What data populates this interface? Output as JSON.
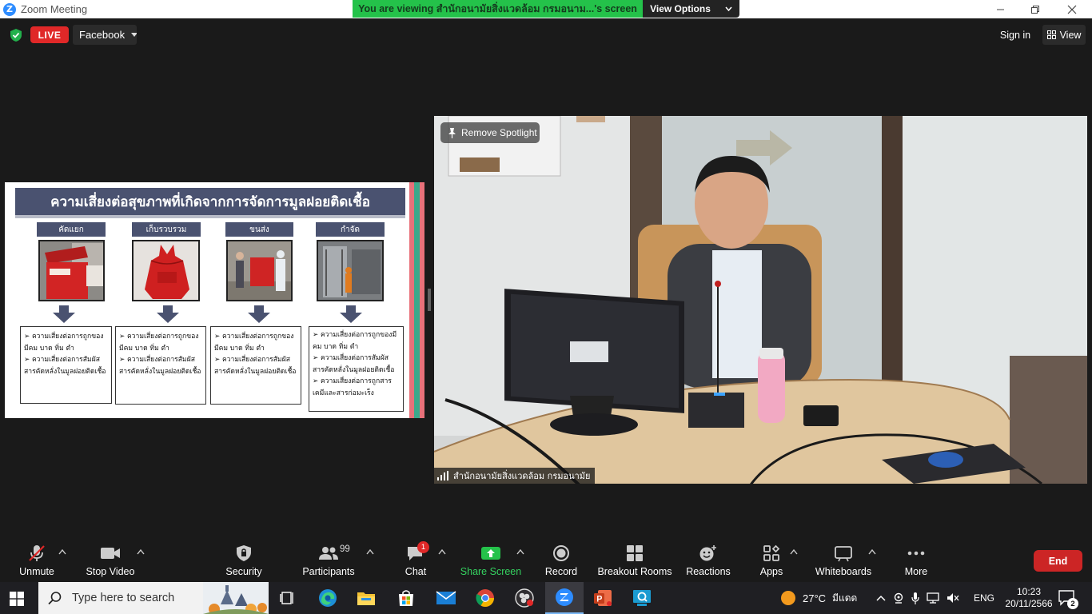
{
  "window": {
    "title": "Zoom Meeting",
    "logo_letter": "Z"
  },
  "banner": {
    "message": "You are viewing สำนักอนามัยสิ่งแวดล้อม กรมอนาม...'s screen",
    "view_options": "View Options"
  },
  "topbar": {
    "live_label": "LIVE",
    "stream_target": "Facebook",
    "sign_in": "Sign in",
    "view": "View"
  },
  "slide": {
    "title": "ความเสี่ยงต่อสุขภาพที่เกิดจากการจัดการมูลฝอยติดเชื้อ",
    "columns": [
      {
        "header": "คัดแยก",
        "bullets": [
          "ความเสี่ยงต่อการถูกของมีคม บาด ทิ่ม ตำ",
          "ความเสี่ยงต่อการสัมผัสสารคัดหลั่งในมูลฝอยติดเชื้อ"
        ]
      },
      {
        "header": "เก็บรวบรวม",
        "bullets": [
          "ความเสี่ยงต่อการถูกของมีคม บาด ทิ่ม ตำ",
          "ความเสี่ยงต่อการสัมผัสสารคัดหลั่งในมูลฝอยติดเชื้อ"
        ]
      },
      {
        "header": "ขนส่ง",
        "bullets": [
          "ความเสี่ยงต่อการถูกของมีคม บาด ทิ่ม ตำ",
          "ความเสี่ยงต่อการสัมผัสสารคัดหลั่งในมูลฝอยติดเชื้อ"
        ]
      },
      {
        "header": "กำจัด",
        "bullets": [
          "ความเสี่ยงต่อการถูกของมีคม บาด ทิ่ม ตำ",
          "ความเสี่ยงต่อการสัมผัสสารคัดหลั่งในมูลฝอยติดเชื้อ",
          "ความเสี่ยงต่อการถูกสารเคมีและสารก่อมะเร็ง"
        ]
      }
    ]
  },
  "video": {
    "remove_spotlight": "Remove Spotlight",
    "participant_name": "สำนักอนามัยสิ่งแวดล้อม กรมอนามัย"
  },
  "toolbar": {
    "unmute": "Unmute",
    "stop_video": "Stop Video",
    "security": "Security",
    "participants": "Participants",
    "participants_count": "99",
    "chat": "Chat",
    "chat_badge": "1",
    "share_screen": "Share Screen",
    "record": "Record",
    "breakout_rooms": "Breakout Rooms",
    "reactions": "Reactions",
    "apps": "Apps",
    "whiteboards": "Whiteboards",
    "more": "More",
    "end": "End"
  },
  "taskbar": {
    "search_placeholder": "Type here to search",
    "weather_temp": "27°C",
    "weather_desc": "มีแดด",
    "language": "ENG",
    "time": "10:23",
    "date": "20/11/2566",
    "notification_count": "2"
  },
  "colors": {
    "zoom_blue": "#2d8cff",
    "banner_green": "#24c24a",
    "live_red": "#e02828",
    "end_red": "#cc2525",
    "share_green": "#24c24a",
    "slide_header": "#4a5270"
  }
}
